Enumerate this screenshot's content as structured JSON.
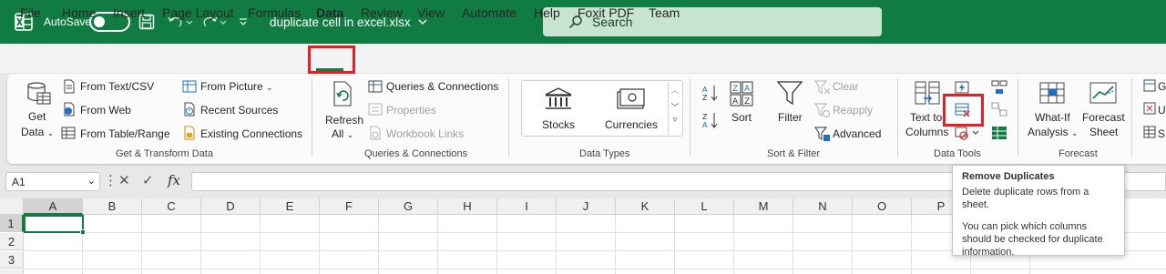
{
  "titlebar": {
    "autosave_label": "AutoSave",
    "autosave_state": "Off",
    "document_title": "duplicate cell in excel.xlsx",
    "search_placeholder": "Search",
    "bg_color": "#107c41"
  },
  "menu": {
    "tabs": [
      "File",
      "Home",
      "Insert",
      "Page Layout",
      "Formulas",
      "Data",
      "Review",
      "View",
      "Automate",
      "Help",
      "Foxit PDF",
      "Team"
    ],
    "active_tab": "Data"
  },
  "ribbon": {
    "get_transform": {
      "get_data_line1": "Get",
      "get_data_line2": "Data",
      "from_text_csv": "From Text/CSV",
      "from_web": "From Web",
      "from_table_range": "From Table/Range",
      "from_picture": "From Picture",
      "recent_sources": "Recent Sources",
      "existing_connections": "Existing Connections",
      "label": "Get & Transform Data"
    },
    "queries": {
      "refresh_line1": "Refresh",
      "refresh_line2": "All",
      "queries_connections": "Queries & Connections",
      "properties": "Properties",
      "workbook_links": "Workbook Links",
      "label": "Queries & Connections"
    },
    "data_types": {
      "stocks": "Stocks",
      "currencies": "Currencies",
      "label": "Data Types"
    },
    "sort_filter": {
      "sort": "Sort",
      "filter": "Filter",
      "clear": "Clear",
      "reapply": "Reapply",
      "advanced": "Advanced",
      "label": "Sort & Filter"
    },
    "data_tools": {
      "text_to_columns_line1": "Text to",
      "text_to_columns_line2": "Columns",
      "label": "Data Tools"
    },
    "forecast": {
      "what_if_line1": "What-If",
      "what_if_line2": "Analysis",
      "forecast_sheet_line1": "Forecast",
      "forecast_sheet_line2": "Sheet",
      "label": "Forecast"
    },
    "outline_partial": [
      "G",
      "U",
      "S"
    ]
  },
  "formula_bar": {
    "name_box": "A1",
    "fx": "fx",
    "formula": ""
  },
  "grid": {
    "columns": [
      "A",
      "B",
      "C",
      "D",
      "E",
      "F",
      "G",
      "H",
      "I",
      "J",
      "K",
      "L",
      "M",
      "N",
      "O",
      "P"
    ],
    "rows": [
      "1",
      "2",
      "3"
    ],
    "selected_cell": "A1"
  },
  "tooltip": {
    "title": "Remove Duplicates",
    "description": "Delete duplicate rows from a sheet.",
    "detail": "You can pick which columns should be checked for duplicate information."
  },
  "highlight_color": "#e51f26",
  "accent_color": "#107c41"
}
